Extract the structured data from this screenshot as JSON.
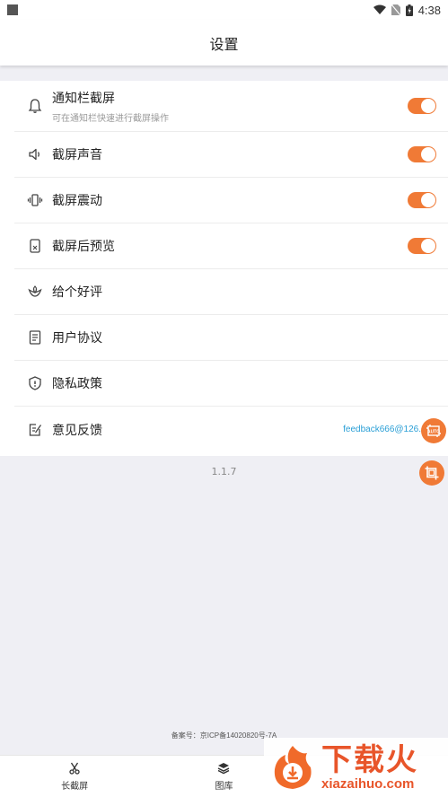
{
  "status_bar": {
    "time": "4:38"
  },
  "header": {
    "title": "设置"
  },
  "settings": {
    "items": [
      {
        "label": "通知栏截屏",
        "sub": "可在通知栏快速进行截屏操作",
        "icon": "bell-icon",
        "toggle": true
      },
      {
        "label": "截屏声音",
        "icon": "speaker-icon",
        "toggle": true
      },
      {
        "label": "截屏震动",
        "icon": "vibrate-icon",
        "toggle": true
      },
      {
        "label": "截屏后预览",
        "icon": "phone-preview-icon",
        "toggle": true
      },
      {
        "label": "给个好评",
        "icon": "flower-icon"
      },
      {
        "label": "用户协议",
        "icon": "document-icon"
      },
      {
        "label": "隐私政策",
        "icon": "shield-icon"
      },
      {
        "label": "意见反馈",
        "icon": "feedback-icon",
        "email": "feedback666@126."
      }
    ]
  },
  "version": "1.1.7",
  "icp": "备案号：京ICP备14020820号-7A",
  "tabs": [
    {
      "label": "长截屏",
      "icon": "scissors-icon"
    },
    {
      "label": "图库",
      "icon": "layers-icon"
    }
  ],
  "watermark": {
    "cn": "下载火",
    "en": "xiazaihuo.com"
  },
  "colors": {
    "accent": "#f07a36",
    "link": "#2a9fd6",
    "background": "#efeff4"
  }
}
